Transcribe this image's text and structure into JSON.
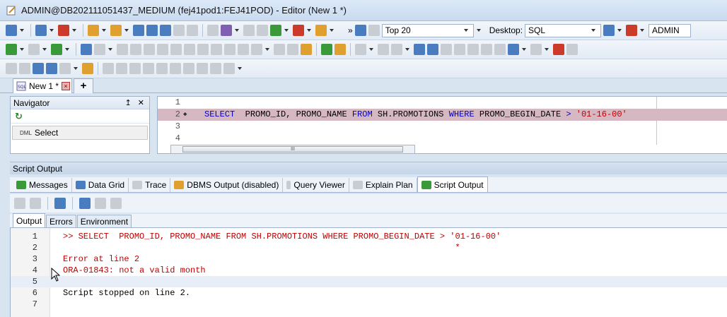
{
  "window": {
    "title": "ADMIN@DB202111051437_MEDIUM (fej41pod1:FEJ41POD) - Editor (New 1 *)"
  },
  "toolbar": {
    "rows_combo": "Top 20",
    "desktop_label": "Desktop:",
    "desktop_combo": "SQL",
    "connection_combo": "ADMIN"
  },
  "tabs": {
    "document": "New 1 *",
    "add": "+"
  },
  "navigator": {
    "title": "Navigator",
    "pin": "↥ ✕",
    "item_prefix": "DML",
    "item": "Select"
  },
  "editor": {
    "lines": [
      {
        "num": "1",
        "code": ""
      },
      {
        "num": "2",
        "code": "SELECT  PROMO_ID, PROMO_NAME FROM SH.PROMOTIONS WHERE PROMO_BEGIN_DATE > '01-16-00'"
      },
      {
        "num": "3",
        "code": ""
      },
      {
        "num": "4",
        "code": ""
      }
    ],
    "sql_parts": {
      "kw_select": "SELECT",
      "cols": "  PROMO_ID, PROMO_NAME ",
      "kw_from": "FROM",
      "table": " SH.PROMOTIONS ",
      "kw_where": "WHERE",
      "cond": " PROMO_BEGIN_DATE ",
      "op": ">",
      "literal": " '01-16-00'"
    },
    "scroll_grip": "III"
  },
  "script_output": {
    "title": "Script Output",
    "subtabs": [
      "Messages",
      "Data Grid",
      "Trace",
      "DBMS Output (disabled)",
      "Query Viewer",
      "Explain Plan",
      "Script Output"
    ],
    "output_tabs": [
      "Output",
      "Errors",
      "Environment"
    ],
    "lines": [
      {
        "num": "1",
        "text": ">> SELECT  PROMO_ID, PROMO_NAME FROM SH.PROMOTIONS WHERE PROMO_BEGIN_DATE > '01-16-00'",
        "style": "err"
      },
      {
        "num": "2",
        "text": "                                                                             *",
        "style": "err"
      },
      {
        "num": "3",
        "text": "Error at line 2",
        "style": "err"
      },
      {
        "num": "4",
        "text": "ORA-01843: not a valid month",
        "style": "err"
      },
      {
        "num": "5",
        "text": "",
        "style": "cur"
      },
      {
        "num": "6",
        "text": "Script stopped on line 2.",
        "style": ""
      },
      {
        "num": "7",
        "text": "",
        "style": ""
      }
    ]
  },
  "colors": {
    "keyword": "#0000c8",
    "string": "#c00000",
    "error": "#c00000",
    "highlight": "#d6b8c2"
  }
}
